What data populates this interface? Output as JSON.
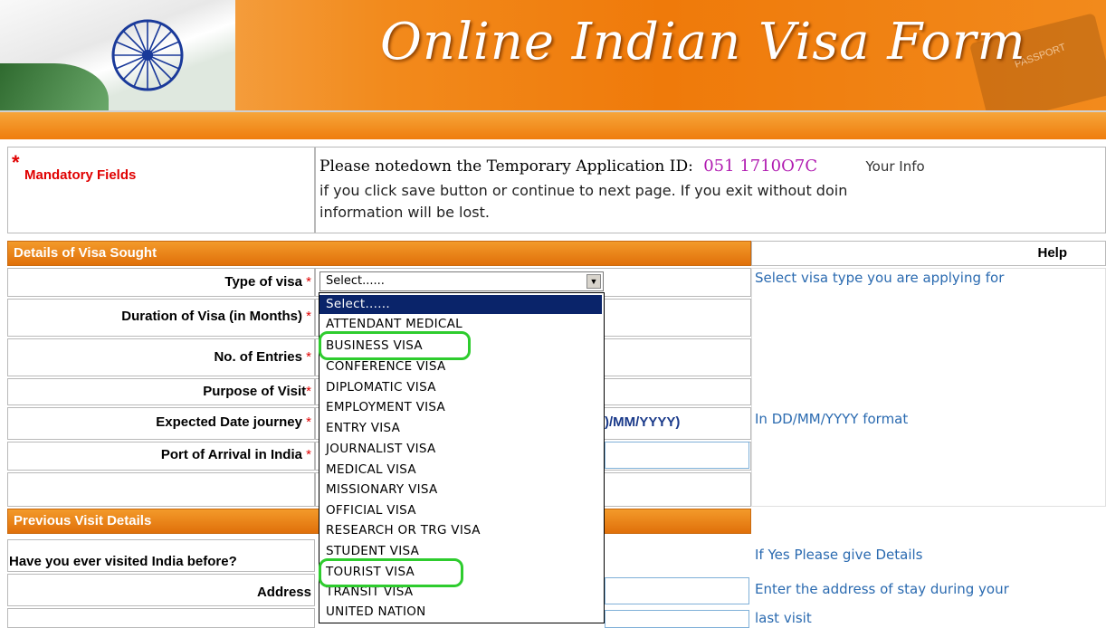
{
  "header": {
    "title": "Online Indian Visa Form",
    "passport_text": "PASSPORT"
  },
  "mandatory": {
    "star": "*",
    "label": "Mandatory Fields"
  },
  "notice": {
    "prefix": "Please notedown the Temporary Application ID:",
    "app_id": "051 1710O7C",
    "suffix": "Your Info",
    "line2": "if you click save button or continue to next page. If you exit without doin",
    "line3": "information will be lost."
  },
  "sections": {
    "visa": "Details of Visa Sought",
    "help": "Help",
    "previous": "Previous Visit Details"
  },
  "fields": {
    "type_of_visa": "Type of visa",
    "duration": "Duration of Visa (in Months)",
    "entries": "No. of Entries",
    "purpose": "Purpose of Visit",
    "journey_date": "Expected Date journey",
    "port": "Port of Arrival in India",
    "visited_before": "Have you ever visited India before?",
    "address": "Address",
    "required_mark": "*"
  },
  "date_format_hint": ")/MM/YYYY)",
  "help_texts": {
    "visa_type": "Select visa type you are applying for",
    "date": "In DD/MM/YYYY format",
    "visited": "If Yes Please give Details",
    "address": "Enter the address of stay during your",
    "address2": "last visit"
  },
  "visa_select": {
    "value": "Select......",
    "arrow": "▼",
    "options": [
      "Select......",
      "ATTENDANT MEDICAL",
      "BUSINESS VISA",
      "CONFERENCE VISA",
      "DIPLOMATIC VISA",
      "EMPLOYMENT VISA",
      "ENTRY VISA",
      "JOURNALIST VISA",
      "MEDICAL VISA",
      "MISSIONARY VISA",
      "OFFICIAL VISA",
      "RESEARCH OR TRG VISA",
      "STUDENT VISA",
      "TOURIST VISA",
      "TRANSIT VISA",
      "UNITED NATION"
    ]
  },
  "colors": {
    "orange": "#ef7d0d",
    "highlight_ring": "#2ecc2e",
    "help_text": "#2a6ab0",
    "app_id": "#b01ab0"
  }
}
